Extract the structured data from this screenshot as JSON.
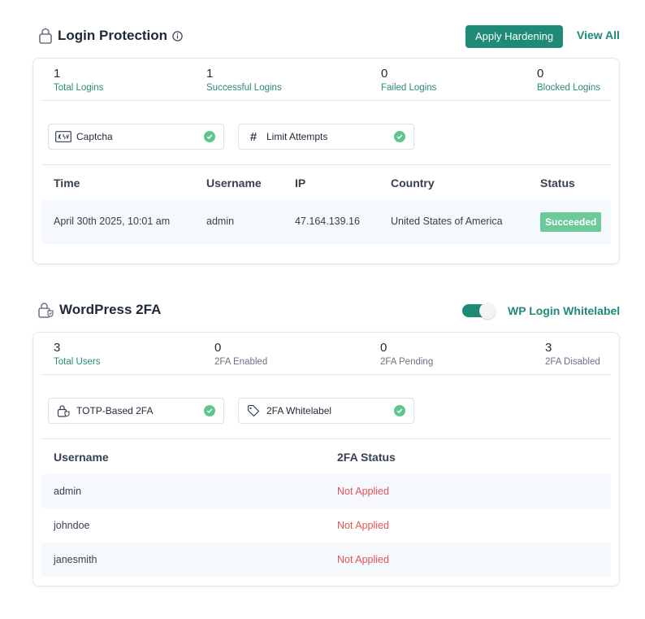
{
  "login_protection": {
    "title": "Login Protection",
    "apply_button": "Apply Hardening",
    "view_all": "View All",
    "stats": [
      {
        "value": "1",
        "label": "Total Logins"
      },
      {
        "value": "1",
        "label": "Successful Logins"
      },
      {
        "value": "0",
        "label": "Failed Logins"
      },
      {
        "value": "0",
        "label": "Blocked Logins"
      }
    ],
    "features": [
      {
        "label": "Captcha",
        "icon": "captcha-icon"
      },
      {
        "label": "Limit Attempts",
        "icon": "hash-icon"
      }
    ],
    "table": {
      "headers": [
        "Time",
        "Username",
        "IP",
        "Country",
        "Status"
      ],
      "rows": [
        {
          "time": "April 30th 2025, 10:01 am",
          "username": "admin",
          "ip": "47.164.139.16",
          "country": "United States of America",
          "status": "Succeeded"
        }
      ]
    }
  },
  "twofa": {
    "title": "WordPress 2FA",
    "toggle_on": true,
    "whitelabel_link": "WP Login Whitelabel",
    "stats": [
      {
        "value": "3",
        "label": "Total Users"
      },
      {
        "value": "0",
        "label": "2FA Enabled"
      },
      {
        "value": "0",
        "label": "2FA Pending"
      },
      {
        "value": "3",
        "label": "2FA Disabled"
      }
    ],
    "features": [
      {
        "label": "TOTP-Based 2FA",
        "icon": "lock-icon"
      },
      {
        "label": "2FA Whitelabel",
        "icon": "tag-icon"
      }
    ],
    "table": {
      "headers": [
        "Username",
        "2FA Status"
      ],
      "rows": [
        {
          "username": "admin",
          "status": "Not Applied"
        },
        {
          "username": "johndoe",
          "status": "Not Applied"
        },
        {
          "username": "janesmith",
          "status": "Not Applied"
        }
      ]
    }
  },
  "colors": {
    "accent": "#1e8a77",
    "success": "#6cc99a",
    "danger": "#e4525a"
  }
}
